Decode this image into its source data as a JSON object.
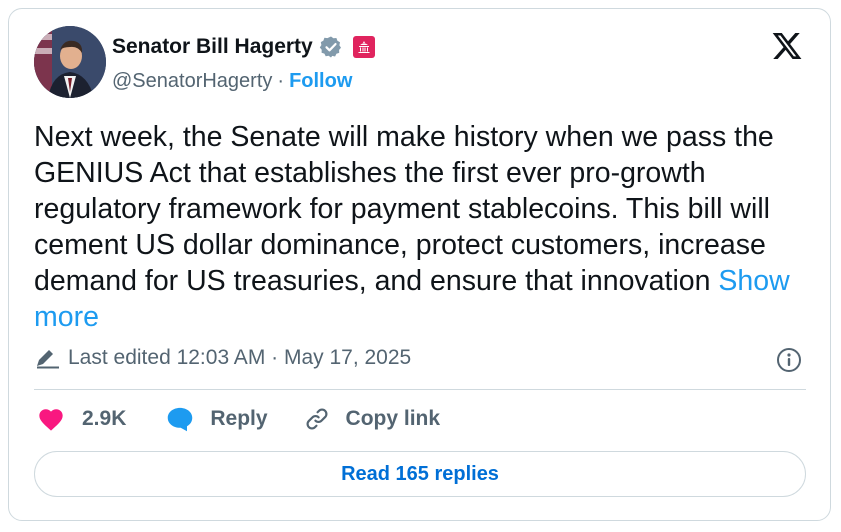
{
  "author": {
    "name": "Senator Bill Hagerty",
    "handle": "@SenatorHagerty",
    "separator": "·",
    "follow_label": "Follow"
  },
  "icons": {
    "verified": "verified-badge-icon",
    "affiliation": "senate-affiliation-icon",
    "brand": "x-logo-icon",
    "edit": "pencil-icon",
    "info": "info-icon",
    "like": "heart-icon",
    "reply": "speech-bubble-icon",
    "copy": "link-icon"
  },
  "colors": {
    "accent": "#1d9bf0",
    "like": "#f91880",
    "affiliation": "#e0245e",
    "text": "#0f1419",
    "muted": "#536471",
    "border": "#cfd9de",
    "read_replies": "#006fd6"
  },
  "tweet": {
    "text": "Next week, the Senate will make history when we pass the GENIUS Act that establishes the first ever pro-growth regulatory framework for payment stablecoins. This bill will cement US dollar dominance, protect customers, increase demand for US treasuries, and ensure that innovation ",
    "show_more": "Show more",
    "edited_label": "Last edited 12:03 AM · May 17, 2025"
  },
  "actions": {
    "likes": "2.9K",
    "reply": "Reply",
    "copy_link": "Copy link"
  },
  "read_replies": "Read 165 replies"
}
